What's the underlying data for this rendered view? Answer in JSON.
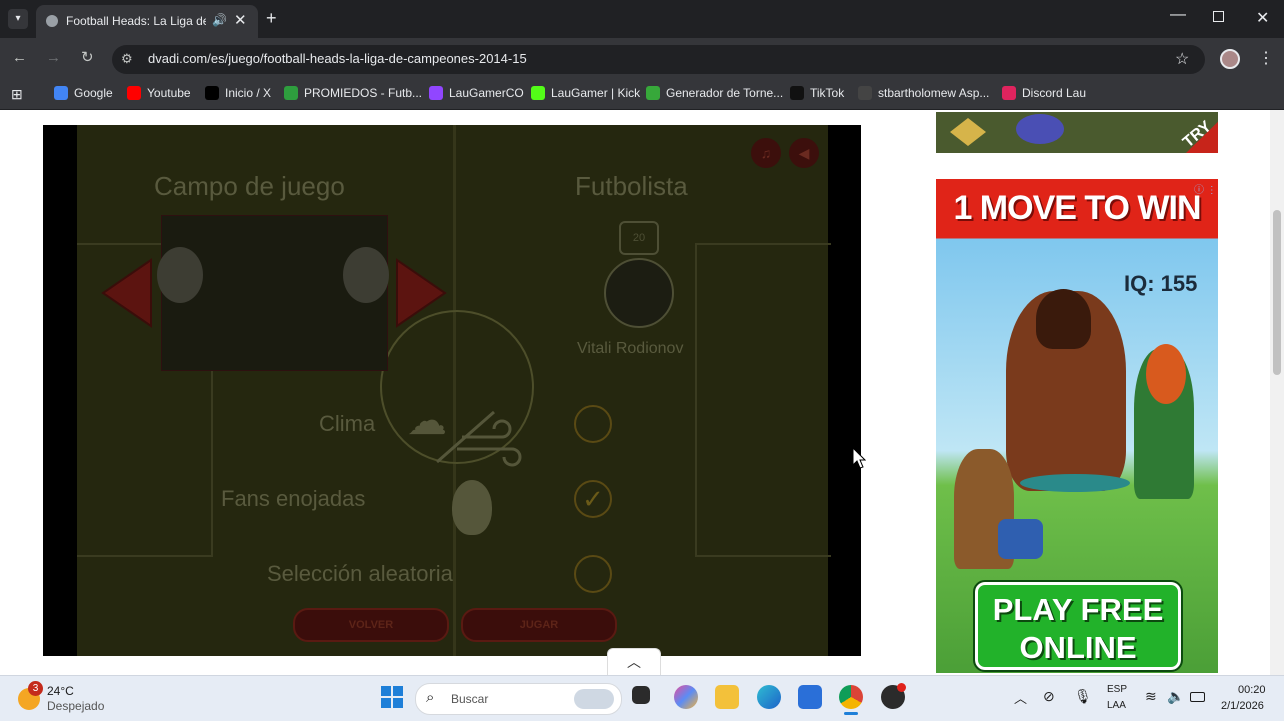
{
  "browser": {
    "tab_title": "Football Heads: La Liga de Campeones",
    "url": "dvadi.com/es/juego/football-heads-la-liga-de-campeones-2014-15",
    "bookmarks": [
      {
        "label": "Google",
        "color": "#4285f4"
      },
      {
        "label": "Youtube",
        "color": "#ff0000"
      },
      {
        "label": "Inicio / X",
        "color": "#000000"
      },
      {
        "label": "PROMIEDOS - Futb...",
        "color": "#2e9e3e"
      },
      {
        "label": "LauGamerCO",
        "color": "#9146ff"
      },
      {
        "label": "LauGamer | Kick",
        "color": "#53fc18"
      },
      {
        "label": "Generador de Torne...",
        "color": "#37a83a"
      },
      {
        "label": "TikTok",
        "color": "#111111"
      },
      {
        "label": "stbartholomew Asp...",
        "color": "#444444"
      },
      {
        "label": "Discord Lau",
        "color": "#e0245e"
      }
    ]
  },
  "game": {
    "field_title": "Campo de juego",
    "player_title": "Futbolista",
    "player_number": "20",
    "player_name": "Vitali Rodionov",
    "weather_label": "Clima",
    "fans_label": "Fans enojadas",
    "random_label": "Selección aleatoria",
    "back_button": "VOLVER",
    "play_button": "JUGAR",
    "fans_checked": true
  },
  "ads": {
    "top_banner_cta": "TRY",
    "headline": "1 MOVE TO WIN",
    "iq": "IQ: 155",
    "cta": "PLAY FREE ONLINE",
    "cta_line1": "PLAY FREE",
    "cta_line2": "ONLINE"
  },
  "taskbar": {
    "notification_count": "3",
    "temperature": "24°C",
    "weather": "Despejado",
    "search_placeholder": "Buscar",
    "language": "ESP",
    "layout": "LAA",
    "time": "00:20",
    "date": "2/1/2026"
  }
}
